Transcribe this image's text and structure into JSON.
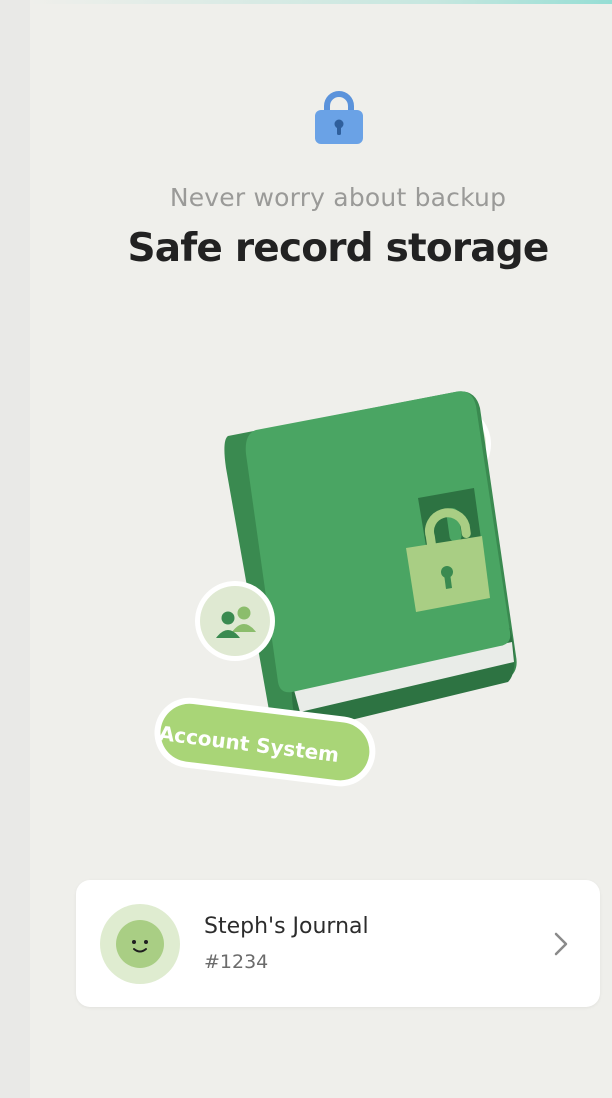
{
  "header": {
    "lock_icon": "lock-icon",
    "subtitle": "Never worry about backup",
    "title": "Safe record storage"
  },
  "illustration": {
    "badge_label": "Account System",
    "book_icon": "locked-journal-icon",
    "colors": {
      "book": "#4aa563",
      "book_spine": "#3a8a50",
      "padlock": "#a9ce84",
      "badge": "#a9d577"
    }
  },
  "journal_card": {
    "name": "Steph's Journal",
    "id": "#1234",
    "avatar_icon": "smiley-avatar-icon",
    "chevron_icon": "chevron-right-icon"
  },
  "colors": {
    "accent_blue": "#6aa2e6",
    "background": "#efefeb"
  }
}
